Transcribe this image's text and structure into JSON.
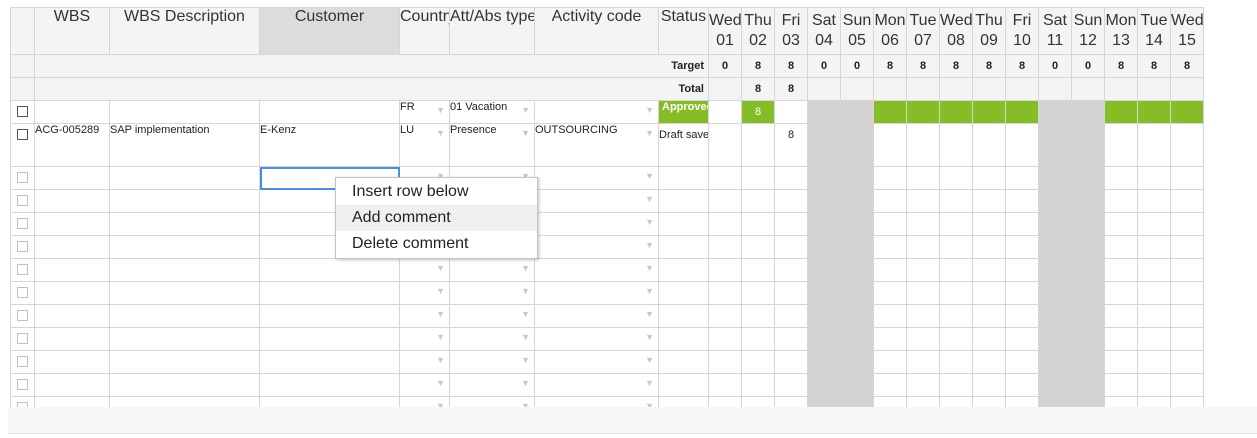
{
  "columns": {
    "wbs": "WBS",
    "wbs_description": "WBS Description",
    "customer": "Customer",
    "country": "Country",
    "att_abs_type": "Att/Abs type",
    "activity_code": "Activity code",
    "status": "Status"
  },
  "days": [
    {
      "dow": "Wed",
      "num": "01",
      "weekend": false
    },
    {
      "dow": "Thu",
      "num": "02",
      "weekend": false
    },
    {
      "dow": "Fri",
      "num": "03",
      "weekend": false
    },
    {
      "dow": "Sat",
      "num": "04",
      "weekend": true
    },
    {
      "dow": "Sun",
      "num": "05",
      "weekend": true
    },
    {
      "dow": "Mon",
      "num": "06",
      "weekend": false
    },
    {
      "dow": "Tue",
      "num": "07",
      "weekend": false
    },
    {
      "dow": "Wed",
      "num": "08",
      "weekend": false
    },
    {
      "dow": "Thu",
      "num": "09",
      "weekend": false
    },
    {
      "dow": "Fri",
      "num": "10",
      "weekend": false
    },
    {
      "dow": "Sat",
      "num": "11",
      "weekend": true
    },
    {
      "dow": "Sun",
      "num": "12",
      "weekend": true
    },
    {
      "dow": "Mon",
      "num": "13",
      "weekend": false
    },
    {
      "dow": "Tue",
      "num": "14",
      "weekend": false
    },
    {
      "dow": "Wed",
      "num": "15",
      "weekend": false
    }
  ],
  "summary": {
    "target_label": "Target",
    "target": [
      "0",
      "8",
      "8",
      "0",
      "0",
      "8",
      "8",
      "8",
      "8",
      "8",
      "0",
      "0",
      "8",
      "8",
      "8"
    ],
    "total_label": "Total",
    "total": [
      "",
      "8",
      "8",
      "",
      "",
      "",
      "",
      "",
      "",
      "",
      "",
      "",
      "",
      "",
      ""
    ]
  },
  "rows": [
    {
      "wbs": "",
      "wbs_description": "",
      "customer": "",
      "country": "FR",
      "att_abs_type": "01 Vacation",
      "activity_code": "",
      "status": "Approved",
      "hours": [
        "",
        "8",
        "",
        "",
        "",
        "",
        "",
        "",
        "",
        "",
        "",
        "",
        "",
        "",
        ""
      ],
      "green_days": [
        1,
        5,
        6,
        7,
        8,
        9,
        12,
        13,
        14
      ]
    },
    {
      "wbs": "ACG-005289",
      "wbs_description": "SAP implementation",
      "customer": "E-Kenz",
      "country": "LU",
      "att_abs_type": "Presence",
      "activity_code": "OUTSOURCING",
      "status": "Draft saved",
      "hours": [
        "",
        "",
        "8",
        "",
        "",
        "",
        "",
        "",
        "",
        "",
        "",
        "",
        "",
        "",
        ""
      ]
    }
  ],
  "empty_row_count": 11,
  "context_menu": {
    "items": [
      "Insert row below",
      "Add comment",
      "Delete comment"
    ],
    "hovered_index": 1
  },
  "colors": {
    "approved_green": "#86bc25",
    "weekend_gray": "#d3d3d3",
    "header_gray": "#f4f4f4",
    "active_cell_blue": "#4a90d9"
  }
}
